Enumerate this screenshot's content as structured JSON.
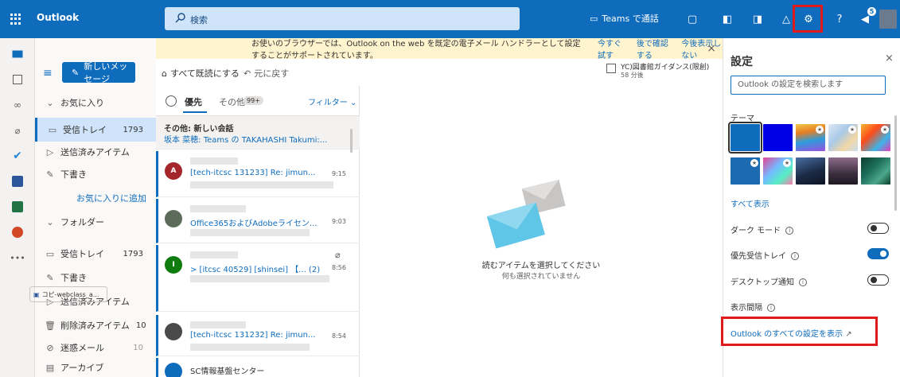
{
  "topbar": {
    "app_name": "Outlook",
    "search_placeholder": "検索",
    "teams_call_label": "Teams で通話",
    "notification_count": "5",
    "accent": "#0f6cbd"
  },
  "infobar": {
    "message": "お使いのブラウザーでは、Outlook on the web を既定の電子メール ハンドラーとして設定することがサポートされています。",
    "try_now": "今すぐ試す",
    "later": "後で確認する",
    "dont_show": "今後表示しない"
  },
  "toolbar": {
    "new_message": "新しいメッセージ",
    "mark_all_read": "すべて既読にする",
    "undo": "元に戻す",
    "calendar_title": "YC)図書館ガイダンス(限創)",
    "calendar_sub": "58 分後"
  },
  "folders": {
    "favorites_header": "お気に入り",
    "fav_inbox": "受信トレイ",
    "fav_inbox_count": "1793",
    "fav_sent": "送信済みアイテム",
    "fav_drafts": "下書き",
    "add_favorite": "お気に入りに追加",
    "folders_header": "フォルダー",
    "inbox": "受信トレイ",
    "inbox_count": "1793",
    "drafts": "下書き",
    "sent": "送信済みアイテム",
    "deleted": "削除済みアイテム",
    "deleted_count": "10",
    "junk": "迷惑メール",
    "junk_count": "10",
    "archive": "アーカイブ"
  },
  "list": {
    "tab_focused": "優先",
    "tab_other": "その他",
    "other_count": "99+",
    "filter": "フィルター",
    "group_line1": "その他: 新しい会話",
    "group_line2": "坂本 菜穂: Teams の TAKAHASHI Takumi:...",
    "items": [
      {
        "initial": "A",
        "subject": "[tech-itcsc 131233] Re: jimun...",
        "time": "9:15"
      },
      {
        "initial": "",
        "subject": "Office365およびAdobeライセン...",
        "time": "9:03"
      },
      {
        "initial": "I",
        "subject": "> [itcsc 40529] [shinsei] 【... (2)",
        "time": "8:56"
      },
      {
        "initial": "",
        "subject": "[tech-itcsc 131232] Re: jimun...",
        "time": "8:54"
      },
      {
        "initial": "",
        "subject": "SC情報基盤センター",
        "time": ""
      }
    ],
    "attachment_name": "コピ-webclass_a..."
  },
  "reading": {
    "empty_title": "読むアイテムを選択してください",
    "empty_sub": "何も選択されていません"
  },
  "settings": {
    "title": "設定",
    "search_placeholder": "Outlook の設定を検索します",
    "theme_label": "テーマ",
    "show_all": "すべて表示",
    "dark_mode": "ダーク モード",
    "dark_mode_on": false,
    "focused_inbox": "優先受信トレイ",
    "focused_inbox_on": true,
    "desktop_notify": "デスクトップ通知",
    "desktop_notify_on": false,
    "density": "表示間隔",
    "view_all_settings": "Outlook のすべての設定を表示"
  }
}
